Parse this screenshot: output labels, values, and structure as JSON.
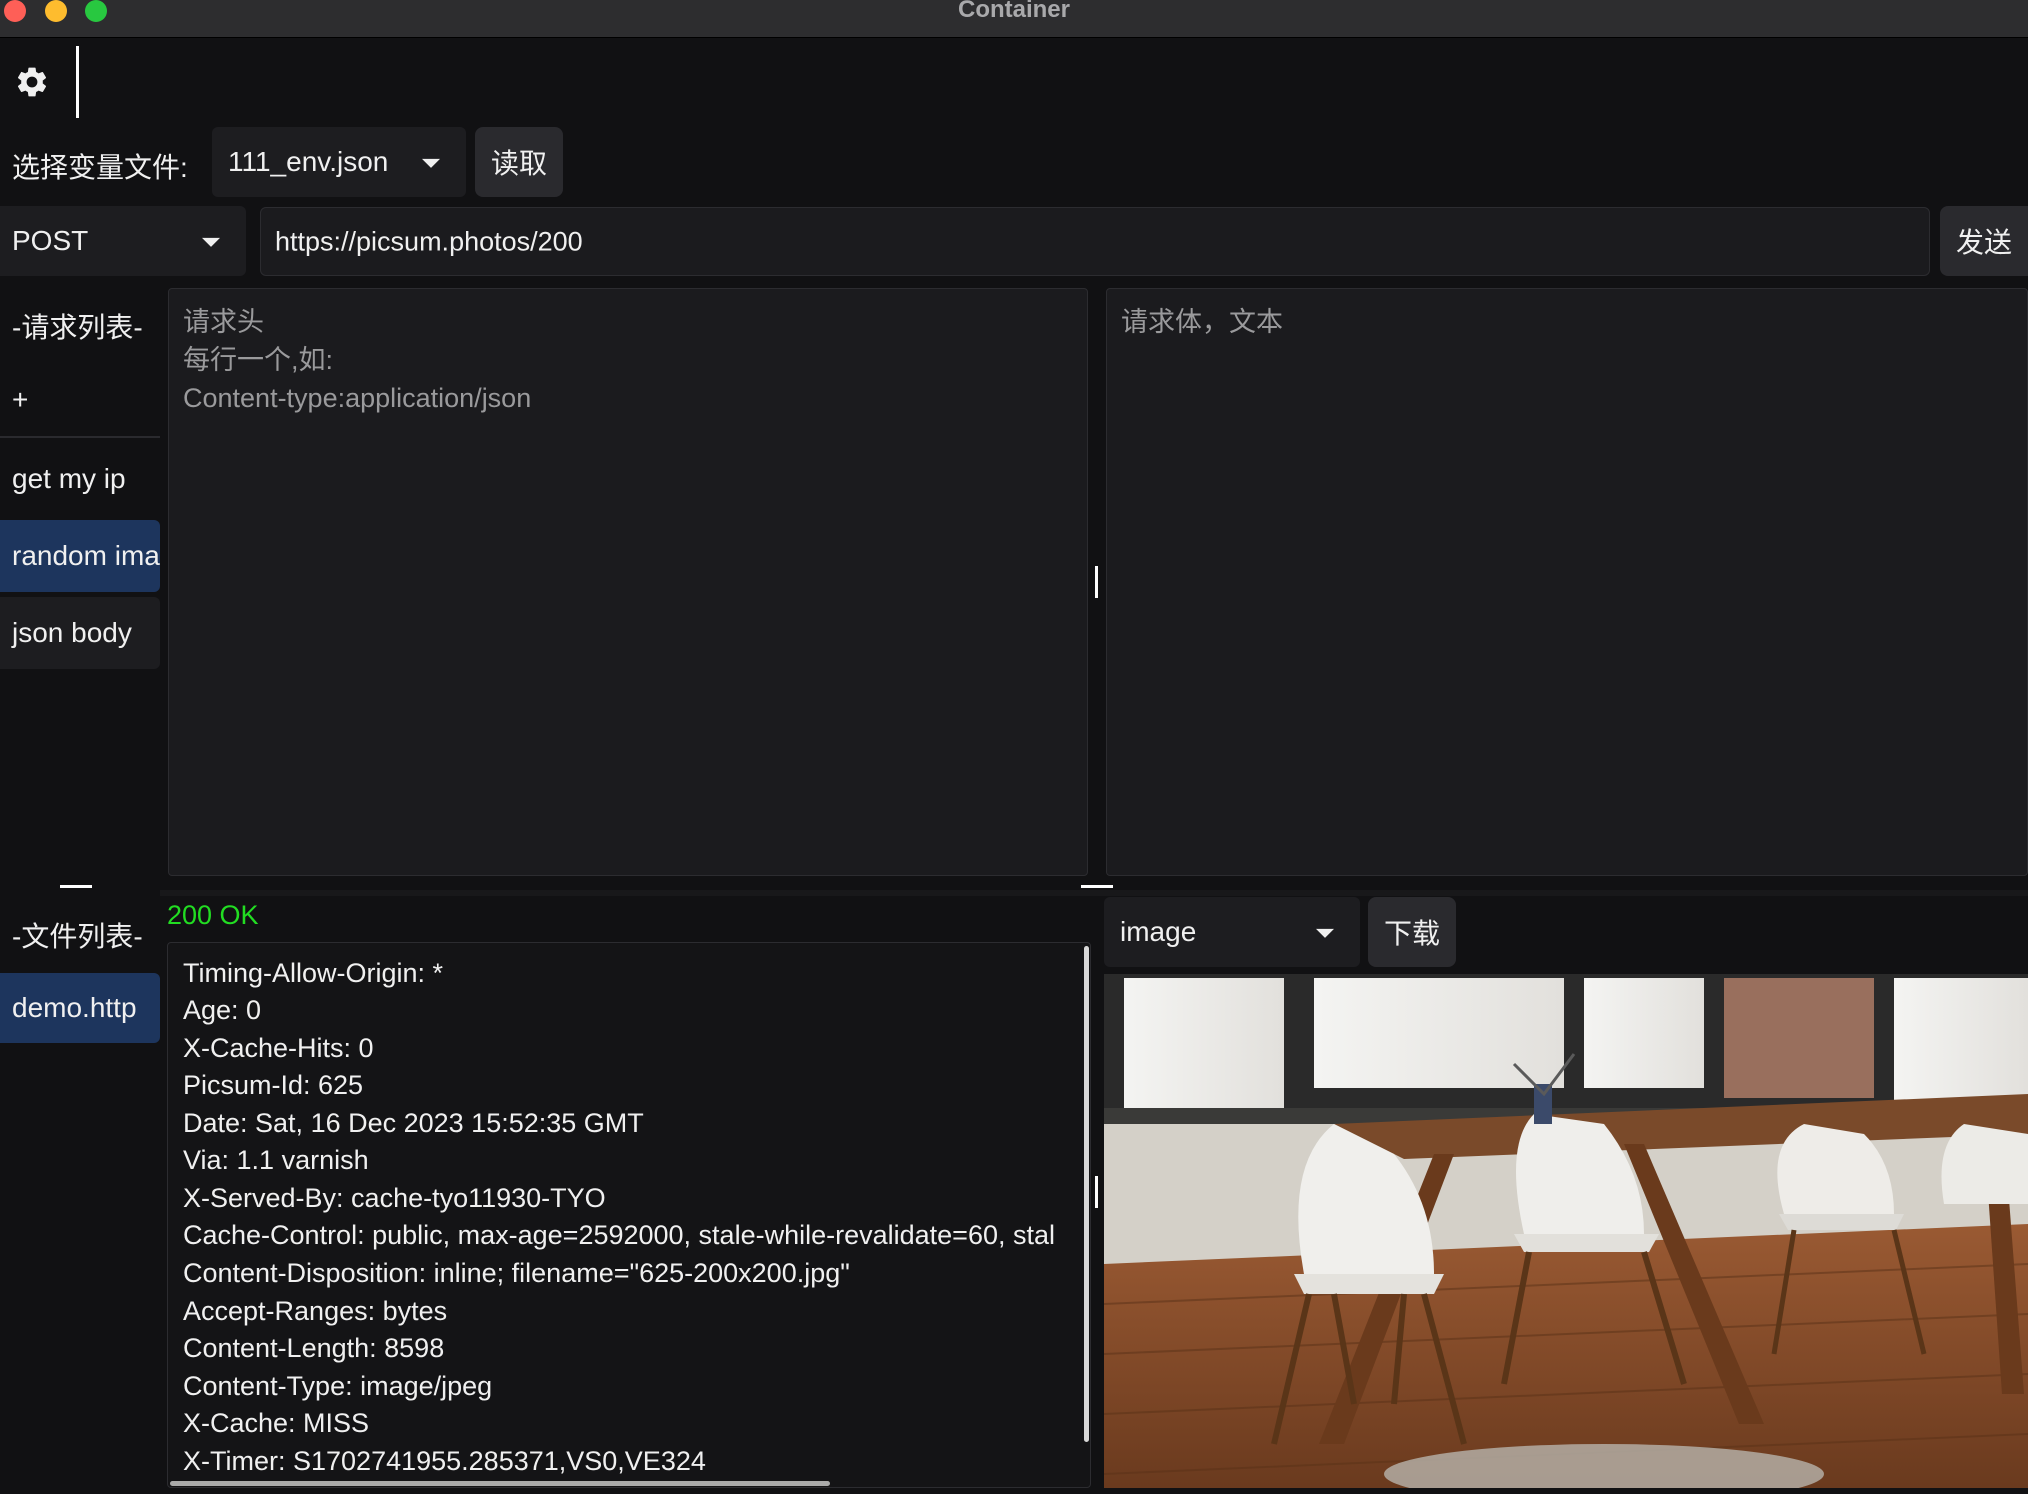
{
  "window": {
    "title": "Container"
  },
  "env": {
    "label": "选择变量文件:",
    "selected": "111_env.json",
    "read_button": "读取"
  },
  "request": {
    "method": "POST",
    "url": "https://picsum.photos/200",
    "send_button": "发送",
    "headers_placeholder": [
      "请求头",
      "每行一个,如:",
      "Content-type:application/json"
    ],
    "body_placeholder": "请求体，文本"
  },
  "request_list": {
    "heading": "-请求列表-",
    "add": "+",
    "items": [
      {
        "label": "get my ip",
        "selected": false
      },
      {
        "label": "random ima",
        "selected": true
      },
      {
        "label": "json body",
        "selected": false
      }
    ]
  },
  "file_list": {
    "heading": "-文件列表-",
    "items": [
      {
        "label": "demo.http",
        "selected": true
      }
    ]
  },
  "response": {
    "status": "200 OK",
    "status_color": "#22dd22",
    "headers": [
      "Timing-Allow-Origin: *",
      "Age: 0",
      "X-Cache-Hits: 0",
      "Picsum-Id: 625",
      "Date: Sat, 16 Dec 2023 15:52:35 GMT",
      "Via: 1.1 varnish",
      "X-Served-By: cache-tyo11930-TYO",
      "Cache-Control: public, max-age=2592000, stale-while-revalidate=60, stal",
      "Content-Disposition: inline; filename=\"625-200x200.jpg\"",
      "Accept-Ranges: bytes",
      "Content-Length: 8598",
      "Content-Type: image/jpeg",
      "X-Cache: MISS",
      "X-Timer: S1702741955.285371,VS0,VE324"
    ],
    "view_mode": "image",
    "download_button": "下载"
  },
  "colors": {
    "selected_item": "#1d355d",
    "background": "#111113",
    "panel": "#1b1b1e"
  }
}
